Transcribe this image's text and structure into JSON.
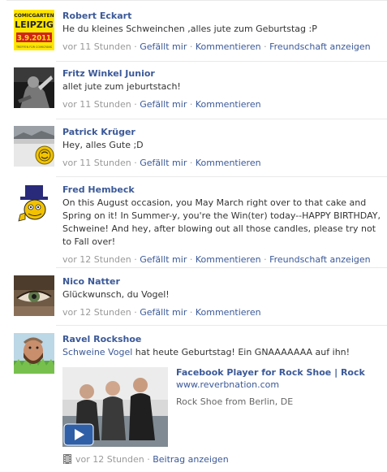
{
  "posts": [
    {
      "name": "Robert Eckart",
      "message": "He du kleines Schweinchen ,alles jute zum Geburtstag :P",
      "time": "vor 11 Stunden",
      "actions": [
        "Gefällt mir",
        "Kommentieren",
        "Freundschaft anzeigen"
      ],
      "avatar": {
        "icon": "comicgarten-leipzig-avatar",
        "top_text": "COMICGARTEN",
        "main_text": "LEIPZIG",
        "date_text": "3.9.2011",
        "bottom_text": "TREFFEN FÜR COMICFANS"
      }
    },
    {
      "name": "Fritz Winkel Junior",
      "message": "allet jute zum jeburtstach!",
      "time": "vor 11 Stunden",
      "actions": [
        "Gefällt mir",
        "Kommentieren"
      ],
      "avatar": {
        "icon": "dark-portrait-avatar"
      }
    },
    {
      "name": "Patrick Krüger",
      "message": "Hey, alles Gute ;D",
      "time": "vor 11 Stunden",
      "actions": [
        "Gefällt mir",
        "Kommentieren"
      ],
      "avatar": {
        "icon": "landscape-badge-avatar"
      }
    },
    {
      "name": "Fred Hembeck",
      "message": "On this August occasion, you May March right over to that cake and Spring on it! In Summer-y, you're the Win(ter) today--HAPPY BIRTHDAY, Schweine! And hey, after blowing out all those candles, please try not to Fall over!",
      "time": "vor 12 Stunden",
      "actions": [
        "Gefällt mir",
        "Kommentieren",
        "Freundschaft anzeigen"
      ],
      "avatar": {
        "icon": "cartoon-tophat-avatar"
      }
    },
    {
      "name": "Nico Natter",
      "message": "Glückwunsch, du Vogel!",
      "time": "vor 12 Stunden",
      "actions": [
        "Gefällt mir",
        "Kommentieren"
      ],
      "avatar": {
        "icon": "eye-closeup-avatar"
      }
    },
    {
      "name": "Ravel Rockshoe",
      "message_link": "Schweine Vogel",
      "message_rest": " hat heute Geburtstag! Ein GNAAAAAAA auf ihn!",
      "time": "vor 12 Stunden",
      "actions": [
        "Beitrag anzeigen"
      ],
      "avatar": {
        "icon": "bearded-man-avatar"
      },
      "share": {
        "title": "Facebook Player for Rock Shoe | Rock",
        "url": "www.reverbnation.com",
        "description": "Rock Shoe from Berlin, DE",
        "thumb_icon": "band-photo-play-thumbnail"
      }
    }
  ],
  "colors": {
    "link": "#3b5998",
    "meta": "#999999",
    "text": "#333333",
    "separator": "#e9e9e9"
  }
}
